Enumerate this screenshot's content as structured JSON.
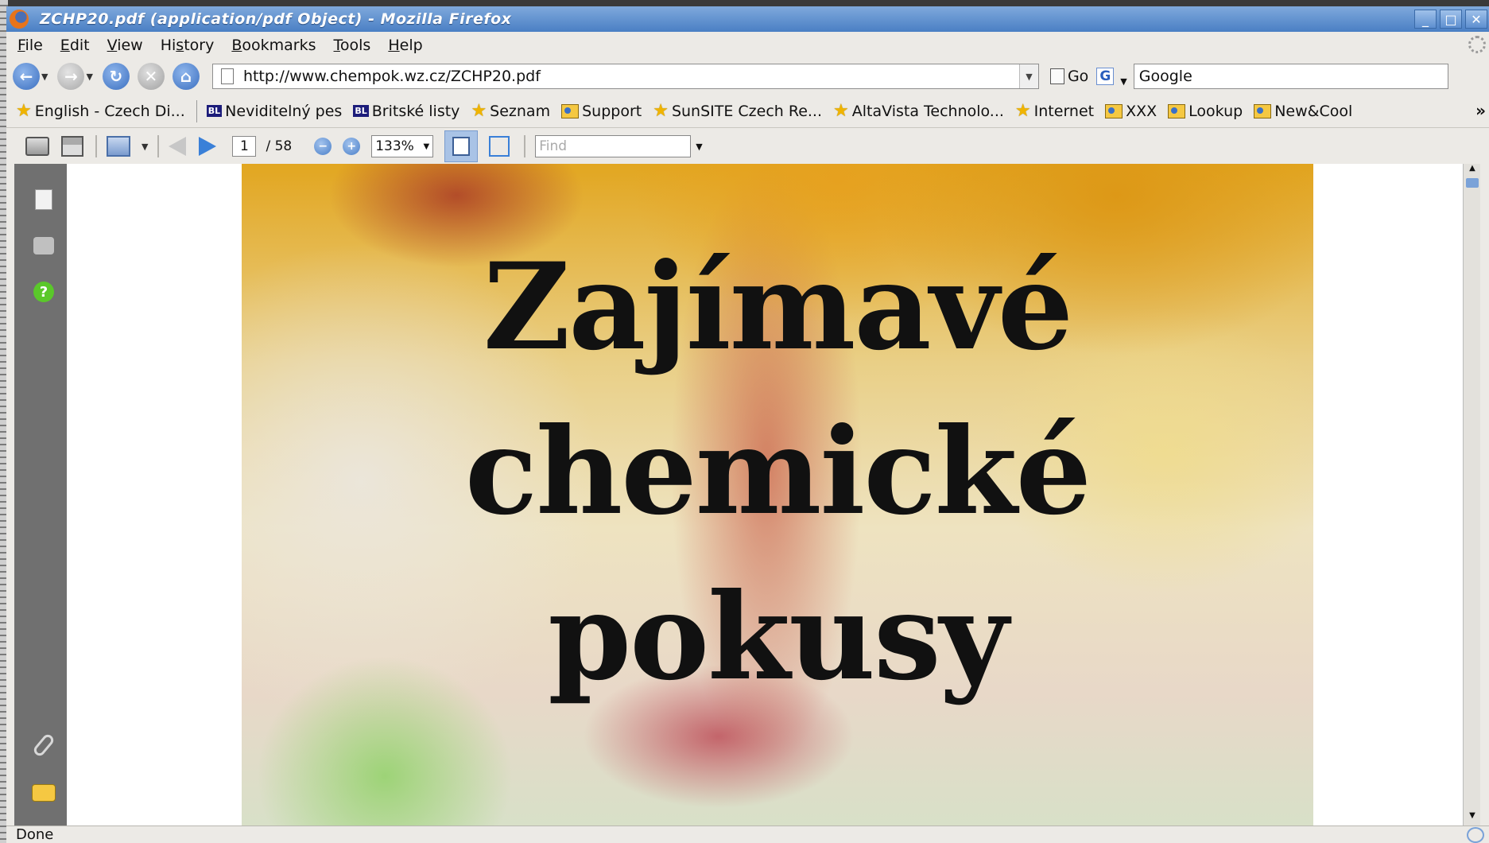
{
  "window": {
    "title": "ZCHP20.pdf (application/pdf Object) - Mozilla Firefox",
    "buttons": [
      "_",
      "□",
      "✕"
    ]
  },
  "menu": {
    "items": [
      {
        "label": "File",
        "accesskey": "F"
      },
      {
        "label": "Edit",
        "accesskey": "E"
      },
      {
        "label": "View",
        "accesskey": "V"
      },
      {
        "label": "History",
        "accesskey": "s"
      },
      {
        "label": "Bookmarks",
        "accesskey": "B"
      },
      {
        "label": "Tools",
        "accesskey": "T"
      },
      {
        "label": "Help",
        "accesskey": "H"
      }
    ]
  },
  "nav": {
    "url": "http://www.chempok.wz.cz/ZCHP20.pdf",
    "go_label": "Go",
    "search_engine_icon": "G",
    "search_value": "Google"
  },
  "bookmarks": {
    "items": [
      {
        "label": "English - Czech Di...",
        "icon": "star"
      },
      {
        "label": "Neviditelný pes",
        "icon": "bl"
      },
      {
        "label": "Britské listy",
        "icon": "bl"
      },
      {
        "label": "Seznam",
        "icon": "star"
      },
      {
        "label": "Support",
        "icon": "feed"
      },
      {
        "label": "SunSITE Czech Re...",
        "icon": "star"
      },
      {
        "label": "AltaVista Technolo...",
        "icon": "star"
      },
      {
        "label": "Internet",
        "icon": "star"
      },
      {
        "label": "XXX",
        "icon": "feed"
      },
      {
        "label": "Lookup",
        "icon": "feed"
      },
      {
        "label": "New&Cool",
        "icon": "feed"
      }
    ],
    "bl_badge": "BL",
    "more_label": "»"
  },
  "pdf_toolbar": {
    "current_page": "1",
    "page_count_label": "/  58",
    "zoom": "133%",
    "find_placeholder": "Find"
  },
  "pdf": {
    "title_lines": [
      "Zajímavé",
      "chemické",
      "pokusy"
    ]
  },
  "status": {
    "text": "Done"
  }
}
